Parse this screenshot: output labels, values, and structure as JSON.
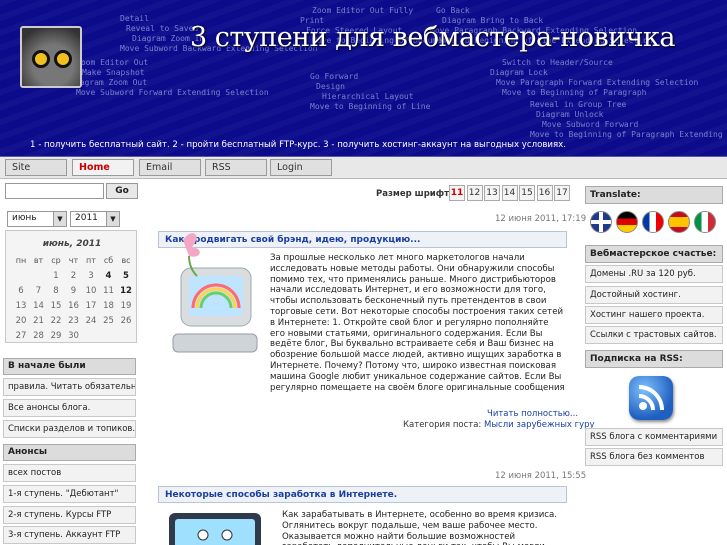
{
  "header": {
    "title": "3 ступени для вебмастера-новичка",
    "tagline": "1 - получить бесплатный сайт. 2 - пройти бесплатный FTP-курс. 3 - получить хостинг-аккаунт на выгодных условиях.",
    "bg_menu_text": [
      "Detail",
      "Zoom Editor Out",
      "Zoom Editor Out Fully",
      "Go Forward",
      "Go Back",
      "Switch to Header/Source",
      "Reveal in Group Tree",
      "Reveal to Saved",
      "Make Snapshot",
      "Print",
      "Design",
      "Diagram Bring to Back",
      "Diagram Lock",
      "Diagram Unlock",
      "Diagram Zoom In",
      "Diagram Zoom Out",
      "Force Steered Layout",
      "Hierarchical Layout",
      "Move Paragraph Backward Extending Selection",
      "Move Paragraph Forward Extending Selection",
      "Move Subword Forward",
      "Move Subword Backward Extending Selection",
      "Move Subword Forward Extending Selection",
      "Move to Beginning of Document",
      "Move to Beginning of Line",
      "Move to Beginning of Line Extending Selection",
      "Move to Beginning of Paragraph",
      "Move to Beginning of Paragraph Extending Selection"
    ]
  },
  "nav": {
    "tabs": [
      {
        "label": "Site",
        "active": false
      },
      {
        "label": "Home",
        "active": true
      },
      {
        "label": "Email",
        "active": false
      },
      {
        "label": "RSS",
        "active": false
      },
      {
        "label": "Login",
        "active": false
      }
    ]
  },
  "search": {
    "button": "Go",
    "value": ""
  },
  "calendar_selects": {
    "month": "июнь",
    "year": "2011"
  },
  "calendar": {
    "title": "июнь, 2011",
    "weekdays": [
      "пн",
      "вт",
      "ср",
      "чт",
      "пт",
      "сб",
      "вс"
    ],
    "weeks": [
      [
        "",
        "",
        "1",
        "2",
        "3",
        "4",
        "5"
      ],
      [
        "6",
        "7",
        "8",
        "9",
        "10",
        "11",
        "12"
      ],
      [
        "13",
        "14",
        "15",
        "16",
        "17",
        "18",
        "19"
      ],
      [
        "20",
        "21",
        "22",
        "23",
        "24",
        "25",
        "26"
      ],
      [
        "27",
        "28",
        "29",
        "30",
        "",
        "",
        ""
      ]
    ]
  },
  "left_boxes": {
    "first_title": "В начале были",
    "first_items": [
      "правила. Читать обязательно!",
      "Все анонсы блога.",
      "Списки разделов и топиков."
    ],
    "second_title": "Анонсы",
    "second_items": [
      "всех постов",
      "1-я ступень. \"Дебютант\"",
      "2-я ступень. Курсы FTP",
      "3-я ступень. Аккаунт FTP",
      "1-я ступень. ..."
    ]
  },
  "font_size": {
    "label": "Размер шрифта:",
    "sizes": [
      "11",
      "12",
      "13",
      "14",
      "15",
      "16",
      "17"
    ],
    "active": "11"
  },
  "posts": [
    {
      "date": "12 июня 2011, 17:19",
      "title": "Как продвигать свой брэнд, идею, продукцию...",
      "text": "За прошлые несколько лет много маркетологов начали исследовать новые методы работы. Они обнаружили способы помимо тех, что применялись раньше. Много дистрибьюторов начали исследовать Интернет, и его возможности для того, чтобы использовать бесконечный путь претендентов в свои торговые сети. Вот некоторые способы построения таких сетей в Интернете: 1. Откройте свой блог и регулярно пополняйте его новыми статьями, оригинального содержания. Если Вы ведёте блог, Вы буквально встраиваете себя и Ваш бизнес на обозрение большой массе людей, активно ищущих заработка в Интернете. Почему? Потому что, широко известная поисковая машина Google любит уникальное содержание сайтов. Если Вы регулярно помещаете на своём блоге оригинальные сообщения то, рано или поздно, Ваш блог появится в результатах поисковой системы, и Вы получите больше посещений на своем сайте. Этот поток посетителей для Вас ценный дар, награда за Ваши труды. 2. Участвуйте в сайтах социальных сетей.",
      "read_more": "Читать полностью...",
      "category_label": "Категория поста:",
      "category": "Мысли зарубежных гуру"
    },
    {
      "date": "12 июня 2011, 15:55",
      "title": "Некоторые способы заработка в Интернете.",
      "text": "Как зарабатывать в Интернете, особенно во время кризиса. Оглянитесь вокруг подальше, чем ваше рабочее место. Оказывается можно найти большие возможностей заработать дополнительные деньги так, чтобы Вы могли пережить спад без финансовых затруднений. Вот несколько"
    }
  ],
  "right": {
    "translate_title": "Translate:",
    "flags": [
      "uk-flag-icon",
      "germany-flag-icon",
      "france-flag-icon",
      "spain-flag-icon",
      "italy-flag-icon"
    ],
    "happiness_title": "Вебмастерское счастье:",
    "happiness_items": [
      "Домены .RU за 120 руб.",
      "Достойный хостинг.",
      "Хостинг нашего проекта.",
      "Ссылки с трастовых сайтов."
    ],
    "rss_title": "Подписка на RSS:",
    "rss_items": [
      "RSS блога с комментариями",
      "RSS блога без комментов"
    ]
  },
  "colors": {
    "header_bg": "#0b0b8c",
    "link": "#1a3fa0",
    "active_tab": "#cc0000"
  }
}
